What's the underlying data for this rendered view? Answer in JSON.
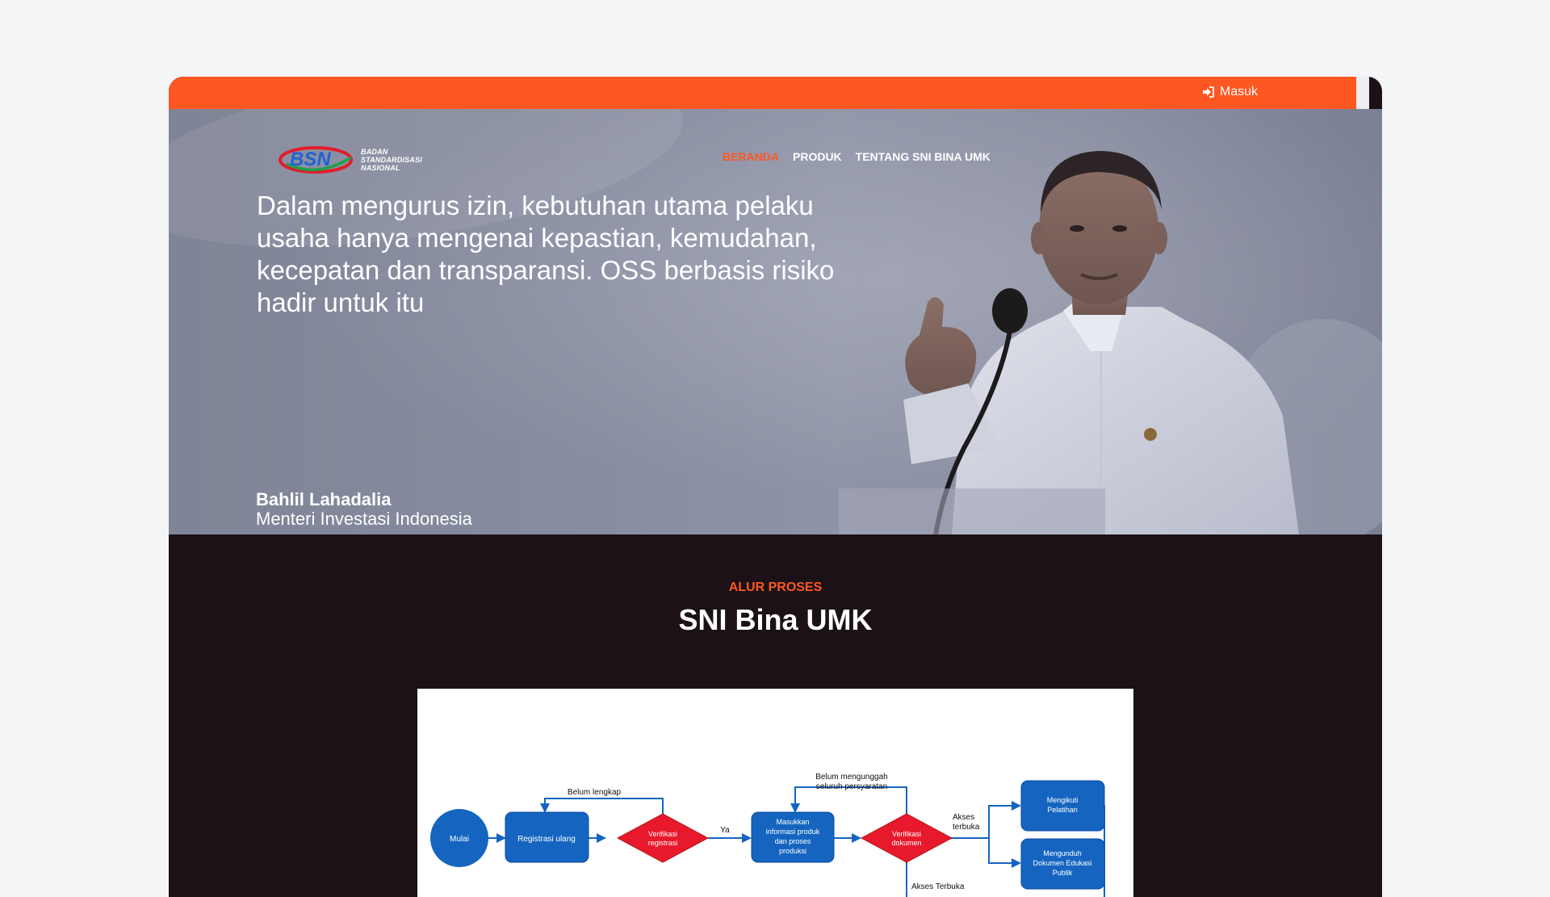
{
  "topbar": {
    "login_label": "Masuk"
  },
  "logo": {
    "mark_text": "BSN",
    "line1": "BADAN",
    "line2": "STANDARDISASI",
    "line3": "NASIONAL"
  },
  "nav": {
    "items": [
      {
        "label": "BERANDA",
        "active": true
      },
      {
        "label": "PRODUK",
        "active": false
      },
      {
        "label": "TENTANG SNI BINA UMK",
        "active": false
      }
    ]
  },
  "hero": {
    "quote": "Dalam mengurus izin, kebutuhan utama pelaku usaha hanya mengenai kepastian, kemudahan, kecepatan dan transparansi. OSS berbasis risiko hadir untuk itu",
    "author_name": "Bahlil Lahadalia",
    "author_role": "Menteri Investasi Indonesia"
  },
  "process": {
    "label": "ALUR PROSES",
    "title": "SNI Bina UMK",
    "flow": {
      "start": "Mulai",
      "registrasi": "Registrasi ulang",
      "verif_reg_1": "Verifikasi",
      "verif_reg_2": "registrasi",
      "belum_lengkap": "Belum lengkap",
      "ya": "Ya",
      "masukkan_1": "Masukkan",
      "masukkan_2": "informasi produk",
      "masukkan_3": "dan proses",
      "masukkan_4": "produksi",
      "belum_unggah_1": "Belum mengunggah",
      "belum_unggah_2": "seluruh persyaratan",
      "verif_dok_1": "Verifikasi",
      "verif_dok_2": "dokumen",
      "akses_terbuka_1": "Akses",
      "akses_terbuka_2": "terbuka",
      "akses_terbuka_bawah": "Akses Terbuka",
      "pelatihan_1": "Mengikuti",
      "pelatihan_2": "Pelatihan",
      "unduh_1": "Mengunduh",
      "unduh_2": "Dokumen Edukasi",
      "unduh_3": "Publik"
    }
  },
  "colors": {
    "accent": "#ff5722",
    "dark_bg": "#1b1116",
    "flow_blue": "#1565c0",
    "flow_red": "#e8192c"
  }
}
